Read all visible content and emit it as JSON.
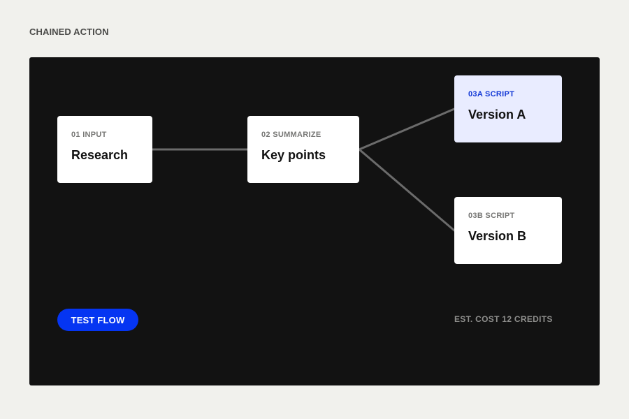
{
  "header": {
    "label": "CHAINED ACTION"
  },
  "flow": {
    "nodes": [
      {
        "step": "01 INPUT",
        "title": "Research"
      },
      {
        "step": "02 SUMMARIZE",
        "title": "Key points"
      },
      {
        "step": "03A SCRIPT",
        "title": "Version A",
        "selected": true
      },
      {
        "step": "03B SCRIPT",
        "title": "Version B"
      }
    ]
  },
  "actions": {
    "test_label": "TEST FLOW",
    "cost_label": "EST. COST 12 CREDITS"
  },
  "colors": {
    "accent": "#0535f2",
    "selected_bg": "#e9ecff",
    "selected_step": "#1238d6",
    "canvas_bg": "#121212",
    "page_bg": "#f1f1ed",
    "connector": "#6b6b6b"
  }
}
